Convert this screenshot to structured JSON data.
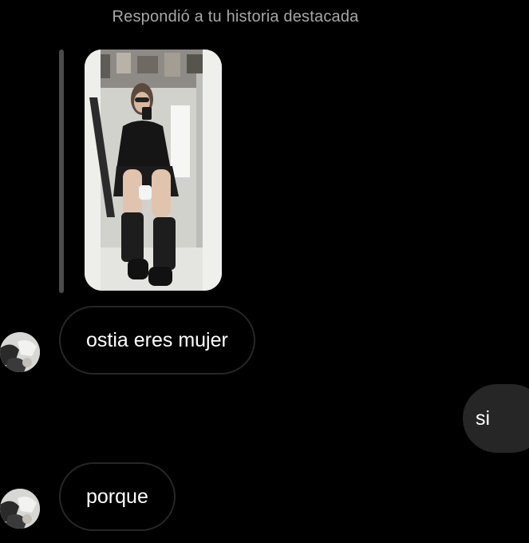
{
  "reply_context": "Respondió a tu historia destacada",
  "story": {
    "thumbnail_icon": "mirror-selfie-photo"
  },
  "messages": [
    {
      "direction": "incoming",
      "text": "ostia eres mujer",
      "avatar_icon": "user-avatar"
    },
    {
      "direction": "outgoing",
      "text": "si"
    },
    {
      "direction": "incoming",
      "text": "porque",
      "avatar_icon": "user-avatar"
    }
  ],
  "colors": {
    "background": "#000000",
    "incoming_bubble_border": "#262626",
    "outgoing_bubble": "#262626",
    "context_text": "#a7a7a7",
    "story_bar": "#4b4b4b"
  }
}
